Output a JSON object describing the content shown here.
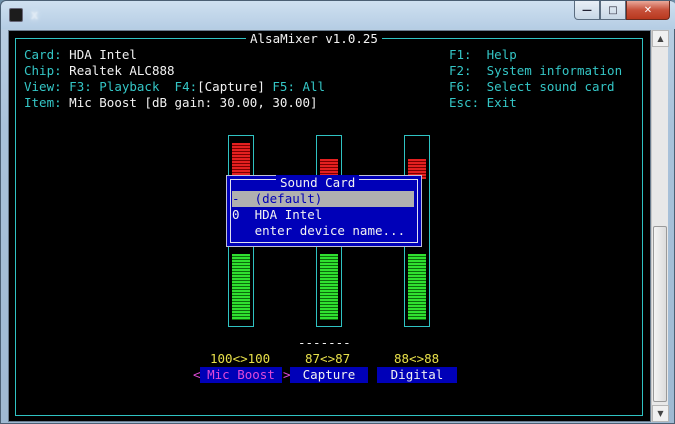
{
  "window": {
    "title": "x"
  },
  "mixer": {
    "title": "AlsaMixer v1.0.25",
    "info": {
      "card_label": "Card:",
      "card_value": "HDA Intel",
      "chip_label": "Chip:",
      "chip_value": "Realtek ALC888",
      "view_label": "View:",
      "view_f3": "F3: Playback",
      "view_f4_key": "F4:",
      "view_f4_value": "[Capture]",
      "view_f5": "F5: All",
      "item_label": "Item:",
      "item_value": "Mic Boost [dB gain: 30.00, 30.00]"
    },
    "help": [
      {
        "key": "F1:",
        "text": "Help"
      },
      {
        "key": "F2:",
        "text": "System information"
      },
      {
        "key": "F6:",
        "text": "Select sound card"
      },
      {
        "key": "Esc:",
        "text": "Exit"
      }
    ],
    "channels": [
      {
        "name": "Mic Boost",
        "volume": "100<>100",
        "level": 1.0,
        "active": true
      },
      {
        "name": "Capture",
        "volume": "87<>87",
        "level": 0.87,
        "active": false
      },
      {
        "name": "Digital",
        "volume": "88<>88",
        "level": 0.88,
        "active": false
      }
    ],
    "dashes": "-------",
    "arrow_left": "<",
    "arrow_right": ">"
  },
  "dialog": {
    "title": "Sound Card",
    "items": [
      {
        "index": "-",
        "label": "(default)",
        "selected": true
      },
      {
        "index": "0",
        "label": "HDA Intel",
        "selected": false
      },
      {
        "index": "",
        "label": "enter device name...",
        "selected": false
      }
    ]
  },
  "colors": {
    "cyan": "#34c6c6",
    "dialog_bg": "#0000b8",
    "volume_yellow": "#e8e04a",
    "active_magenta": "#e04ad8"
  }
}
